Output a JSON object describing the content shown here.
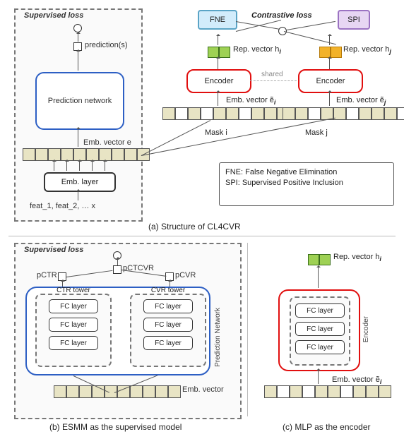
{
  "panel_a": {
    "supervised_title": "Supervised loss",
    "prediction_output": "prediction(s)",
    "prediction_network": "Prediction network",
    "emb_vector_e": "Emb. vector e",
    "emb_layer": "Emb. layer",
    "features": "feat_1, feat_2, …  x"
  },
  "top_right": {
    "fne": "FNE",
    "spi": "SPI",
    "contrastive": "Contrastive loss",
    "rep_left": "Rep. vector h",
    "rep_left_sub": "i",
    "rep_right": "Rep. vector h",
    "rep_right_sub": "j",
    "encoder": "Encoder",
    "shared": "shared",
    "emb_left": "Emb. vector ẽ",
    "emb_left_sub": "i",
    "emb_right": "Emb. vector ẽ",
    "emb_right_sub": "j",
    "mask_left": "Mask i",
    "mask_right": "Mask j"
  },
  "legend": {
    "line1": "FNE: False Negative Elimination",
    "line2": "SPI: Supervised Positive Inclusion"
  },
  "captions": {
    "a": "(a) Structure of CL4CVR",
    "b": "(b) ESMM as the supervised model",
    "c": "(c) MLP as the encoder"
  },
  "panel_b": {
    "supervised_title": "Supervised loss",
    "pctr": "pCTR",
    "pctcvr": "pCTCVR",
    "pcvr": "pCVR",
    "ctr_tower": "CTR tower",
    "cvr_tower": "CVR tower",
    "fc": "FC layer",
    "pred_net_side": "Prediction Network",
    "emb_vector": "Emb. vector"
  },
  "panel_c": {
    "rep": "Rep. vector h",
    "rep_sub": "i",
    "fc": "FC layer",
    "encoder_side": "Encoder",
    "emb": "Emb. vector ẽ",
    "emb_sub": "i"
  }
}
